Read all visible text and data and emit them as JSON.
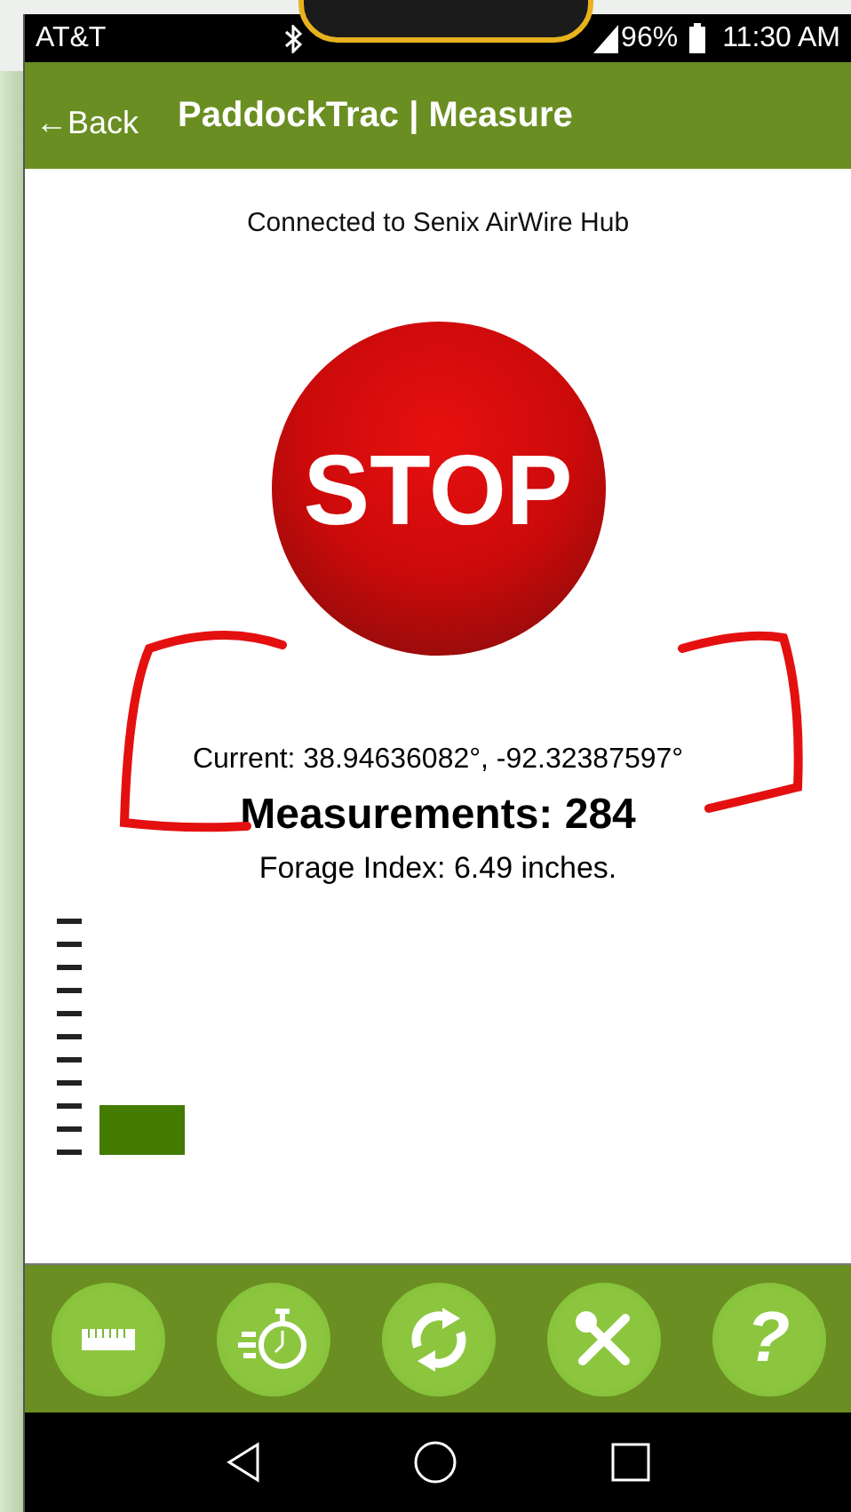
{
  "status_bar": {
    "carrier": "AT&T",
    "battery": "96%",
    "time": "11:30 AM"
  },
  "header": {
    "back": "←Back",
    "title": "PaddockTrac | Measure"
  },
  "connection": "Connected to Senix AirWire Hub",
  "stop_button": {
    "label": "STOP"
  },
  "current": "Current: 38.94636082°, -92.32387597°",
  "measurements": "Measurements: 284",
  "forage_index": "Forage Index: 6.49 inches.",
  "toolbar": [
    {
      "kind": "ruler"
    },
    {
      "kind": "stopwatch"
    },
    {
      "kind": "sync"
    },
    {
      "kind": "tools"
    },
    {
      "kind": "help",
      "label": "?"
    }
  ]
}
